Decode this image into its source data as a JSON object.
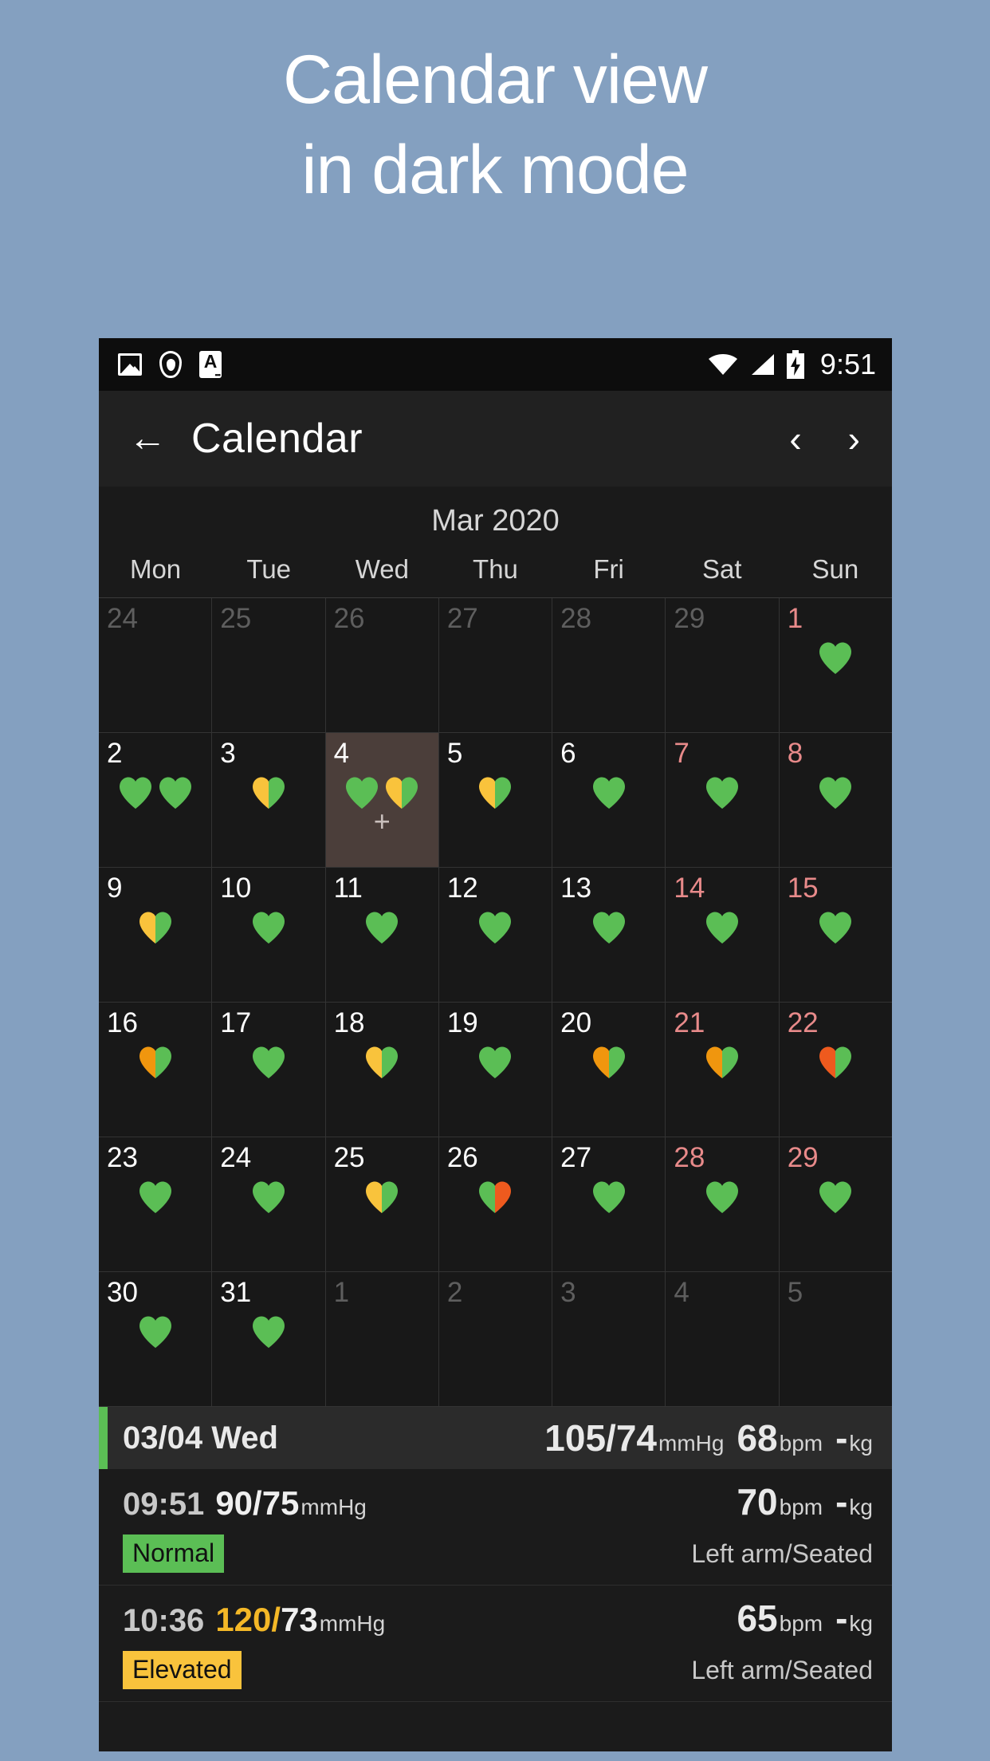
{
  "promo": {
    "line1": "Calendar view",
    "line2": "in dark mode"
  },
  "colors": {
    "page_background": "#84A0C0",
    "app_background": "#191919",
    "heart_green": "#5BBE55",
    "heart_yellow": "#F9C33C",
    "heart_orange": "#F0960E",
    "heart_red": "#EE5A1E",
    "selected_cell": "#4B3E3A",
    "badge_normal": "#5BBE55",
    "badge_elevated": "#F9C33C",
    "weekend_daynum": "#E88A8A"
  },
  "status_bar": {
    "icons": [
      "image-icon",
      "shield-location-icon",
      "alpha-notification-icon"
    ],
    "alpha_letter": "A",
    "right_icons": [
      "wifi-icon",
      "cell-signal-icon",
      "battery-charging-icon"
    ],
    "time": "9:51"
  },
  "toolbar": {
    "back_icon": "←",
    "title": "Calendar",
    "prev_icon": "‹",
    "next_icon": "›"
  },
  "calendar": {
    "month_label": "Mar 2020",
    "weekdays": [
      "Mon",
      "Tue",
      "Wed",
      "Thu",
      "Fri",
      "Sat",
      "Sun"
    ],
    "selected_day": 4,
    "add_marker": "+",
    "rows": [
      [
        {
          "day": "24",
          "style": "dim",
          "hearts": []
        },
        {
          "day": "25",
          "style": "dim",
          "hearts": []
        },
        {
          "day": "26",
          "style": "dim",
          "hearts": []
        },
        {
          "day": "27",
          "style": "dim",
          "hearts": []
        },
        {
          "day": "28",
          "style": "dim",
          "hearts": []
        },
        {
          "day": "29",
          "style": "dim",
          "hearts": []
        },
        {
          "day": "1",
          "style": "red",
          "hearts": [
            {
              "left": "green",
              "right": "green"
            }
          ]
        }
      ],
      [
        {
          "day": "2",
          "style": "normal",
          "hearts": [
            {
              "left": "green",
              "right": "green"
            },
            {
              "left": "green",
              "right": "green"
            }
          ]
        },
        {
          "day": "3",
          "style": "normal",
          "hearts": [
            {
              "left": "yellow",
              "right": "green"
            }
          ]
        },
        {
          "day": "4",
          "style": "normal",
          "selected": true,
          "plus": true,
          "hearts": [
            {
              "left": "green",
              "right": "green"
            },
            {
              "left": "yellow",
              "right": "green"
            }
          ]
        },
        {
          "day": "5",
          "style": "normal",
          "hearts": [
            {
              "left": "yellow",
              "right": "green"
            }
          ]
        },
        {
          "day": "6",
          "style": "normal",
          "hearts": [
            {
              "left": "green",
              "right": "green"
            }
          ]
        },
        {
          "day": "7",
          "style": "red",
          "hearts": [
            {
              "left": "green",
              "right": "green"
            }
          ]
        },
        {
          "day": "8",
          "style": "red",
          "hearts": [
            {
              "left": "green",
              "right": "green"
            }
          ]
        }
      ],
      [
        {
          "day": "9",
          "style": "normal",
          "hearts": [
            {
              "left": "yellow",
              "right": "green"
            }
          ]
        },
        {
          "day": "10",
          "style": "normal",
          "hearts": [
            {
              "left": "green",
              "right": "green"
            }
          ]
        },
        {
          "day": "11",
          "style": "normal",
          "hearts": [
            {
              "left": "green",
              "right": "green"
            }
          ]
        },
        {
          "day": "12",
          "style": "normal",
          "hearts": [
            {
              "left": "green",
              "right": "green"
            }
          ]
        },
        {
          "day": "13",
          "style": "normal",
          "hearts": [
            {
              "left": "green",
              "right": "green"
            }
          ]
        },
        {
          "day": "14",
          "style": "red",
          "hearts": [
            {
              "left": "green",
              "right": "green"
            }
          ]
        },
        {
          "day": "15",
          "style": "red",
          "hearts": [
            {
              "left": "green",
              "right": "green"
            }
          ]
        }
      ],
      [
        {
          "day": "16",
          "style": "normal",
          "hearts": [
            {
              "left": "orange",
              "right": "green"
            }
          ]
        },
        {
          "day": "17",
          "style": "normal",
          "hearts": [
            {
              "left": "green",
              "right": "green"
            }
          ]
        },
        {
          "day": "18",
          "style": "normal",
          "hearts": [
            {
              "left": "yellow",
              "right": "green"
            }
          ]
        },
        {
          "day": "19",
          "style": "normal",
          "hearts": [
            {
              "left": "green",
              "right": "green"
            }
          ]
        },
        {
          "day": "20",
          "style": "normal",
          "hearts": [
            {
              "left": "orange",
              "right": "green"
            }
          ]
        },
        {
          "day": "21",
          "style": "red",
          "hearts": [
            {
              "left": "orange",
              "right": "green"
            }
          ]
        },
        {
          "day": "22",
          "style": "red",
          "hearts": [
            {
              "left": "red",
              "right": "green"
            }
          ]
        }
      ],
      [
        {
          "day": "23",
          "style": "normal",
          "hearts": [
            {
              "left": "green",
              "right": "green"
            }
          ]
        },
        {
          "day": "24",
          "style": "normal",
          "hearts": [
            {
              "left": "green",
              "right": "green"
            }
          ]
        },
        {
          "day": "25",
          "style": "normal",
          "hearts": [
            {
              "left": "yellow",
              "right": "green"
            }
          ]
        },
        {
          "day": "26",
          "style": "normal",
          "hearts": [
            {
              "left": "green",
              "right": "red"
            }
          ]
        },
        {
          "day": "27",
          "style": "normal",
          "hearts": [
            {
              "left": "green",
              "right": "green"
            }
          ]
        },
        {
          "day": "28",
          "style": "red",
          "hearts": [
            {
              "left": "green",
              "right": "green"
            }
          ]
        },
        {
          "day": "29",
          "style": "red",
          "hearts": [
            {
              "left": "green",
              "right": "green"
            }
          ]
        }
      ],
      [
        {
          "day": "30",
          "style": "normal",
          "hearts": [
            {
              "left": "green",
              "right": "green"
            }
          ]
        },
        {
          "day": "31",
          "style": "normal",
          "hearts": [
            {
              "left": "green",
              "right": "green"
            }
          ]
        },
        {
          "day": "1",
          "style": "dim",
          "hearts": []
        },
        {
          "day": "2",
          "style": "dim",
          "hearts": []
        },
        {
          "day": "3",
          "style": "dim",
          "hearts": []
        },
        {
          "day": "4",
          "style": "dim",
          "hearts": []
        },
        {
          "day": "5",
          "style": "dim",
          "hearts": []
        }
      ]
    ]
  },
  "summary": {
    "date": "03/04 Wed",
    "bp": "105/74",
    "bp_unit": "mmHg",
    "pulse": "68",
    "pulse_unit": "bpm",
    "weight": "-",
    "weight_unit": "kg"
  },
  "entries": [
    {
      "time": "09:51",
      "systolic": "90",
      "slash": "/",
      "diastolic": "75",
      "bp_unit": "mmHg",
      "systolic_amber": false,
      "pulse": "70",
      "pulse_unit": "bpm",
      "weight": "-",
      "weight_unit": "kg",
      "badge": "Normal",
      "badge_type": "normal",
      "position": "Left arm/Seated"
    },
    {
      "time": "10:36",
      "systolic": "120",
      "slash": "/",
      "diastolic": "73",
      "bp_unit": "mmHg",
      "systolic_amber": true,
      "pulse": "65",
      "pulse_unit": "bpm",
      "weight": "-",
      "weight_unit": "kg",
      "badge": "Elevated",
      "badge_type": "elevated",
      "position": "Left arm/Seated"
    }
  ]
}
